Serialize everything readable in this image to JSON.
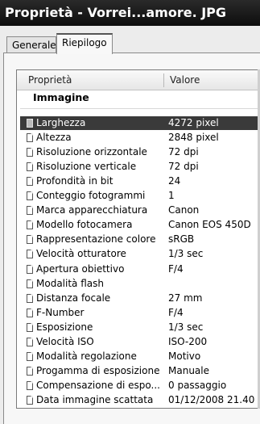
{
  "window": {
    "title": "Proprietà - Vorrei...amore. JPG"
  },
  "tabs": [
    {
      "label": "Generale"
    },
    {
      "label": "Riepilogo"
    }
  ],
  "columns": {
    "property": "Proprietà",
    "value": "Valore"
  },
  "group": {
    "label": "Immagine"
  },
  "rows": [
    {
      "name": "Larghezza",
      "value": "4272 pixel"
    },
    {
      "name": "Altezza",
      "value": "2848 pixel"
    },
    {
      "name": "Risoluzione orizzontale",
      "value": "72 dpi"
    },
    {
      "name": "Risoluzione verticale",
      "value": "72 dpi"
    },
    {
      "name": "Profondità in bit",
      "value": "24"
    },
    {
      "name": "Conteggio fotogrammi",
      "value": "1"
    },
    {
      "name": "Marca apparecchiatura",
      "value": "Canon"
    },
    {
      "name": "Modello fotocamera",
      "value": "Canon EOS 450D"
    },
    {
      "name": "Rappresentazione colore",
      "value": "sRGB"
    },
    {
      "name": "Velocità otturatore",
      "value": "1/3 sec"
    },
    {
      "name": "Apertura obiettivo",
      "value": "F/4"
    },
    {
      "name": "Modalità flash",
      "value": ""
    },
    {
      "name": "Distanza focale",
      "value": "27 mm"
    },
    {
      "name": "F-Number",
      "value": "F/4"
    },
    {
      "name": "Esposizione",
      "value": "1/3 sec"
    },
    {
      "name": "Velocità ISO",
      "value": "ISO-200"
    },
    {
      "name": "Modalità regolazione",
      "value": "Motivo"
    },
    {
      "name": "Progamma di esposizione",
      "value": "Manuale"
    },
    {
      "name": "Compensazione di espo...",
      "value": "0 passaggio"
    },
    {
      "name": "Data immagine scattata",
      "value": "01/12/2008 21.40"
    }
  ],
  "selected_row_index": 0,
  "icons": {
    "row_icon": "document-icon"
  }
}
